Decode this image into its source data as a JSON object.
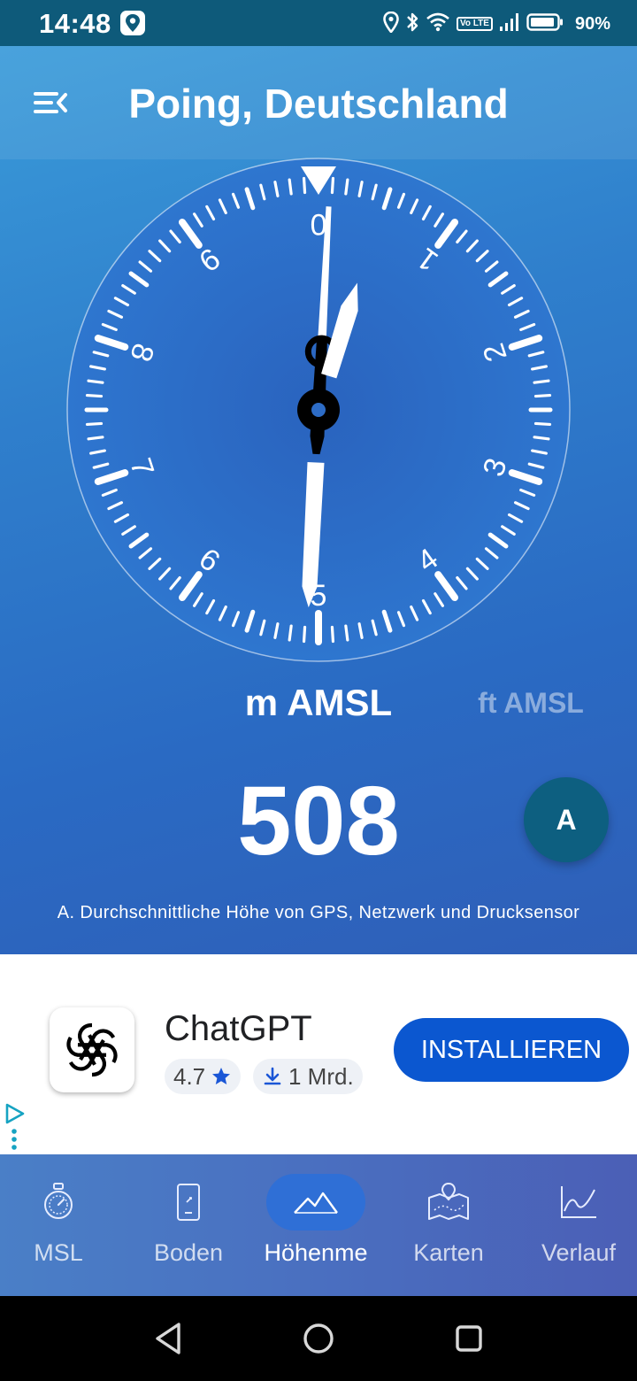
{
  "status_bar": {
    "time": "14:48",
    "battery": "90%",
    "lte": "Vo LTE"
  },
  "header": {
    "title": "Poing, Deutschland",
    "menu_icon": "menu-collapse-icon"
  },
  "gauge": {
    "dial_numbers": [
      "0",
      "1",
      "2",
      "3",
      "4",
      "5",
      "6",
      "7",
      "8",
      "9"
    ],
    "hand_long_value": 0.08,
    "hand_short_value": 0.5
  },
  "units": {
    "primary": "m AMSL",
    "secondary": "ft AMSL"
  },
  "altitude": {
    "value": "508",
    "mode_label": "A",
    "mode_note": "A. Durchschnittliche Höhe von GPS, Netzwerk und Drucksensor"
  },
  "ad": {
    "app_name": "ChatGPT",
    "rating": "4.7",
    "downloads": "1 Mrd.",
    "install_label": "INSTALLIEREN"
  },
  "bottom_nav": {
    "items": [
      {
        "label": "MSL",
        "icon": "compass-icon",
        "active": false
      },
      {
        "label": "Boden",
        "icon": "phone-ground-icon",
        "active": false
      },
      {
        "label": "Höhenme",
        "icon": "mountain-icon",
        "active": true
      },
      {
        "label": "Karten",
        "icon": "map-icon",
        "active": false
      },
      {
        "label": "Verlauf",
        "icon": "chart-line-icon",
        "active": false
      }
    ]
  },
  "colors": {
    "status_bar": "#0e5a7a",
    "accent": "#0b57d0",
    "mode_button": "#0d5f80"
  }
}
